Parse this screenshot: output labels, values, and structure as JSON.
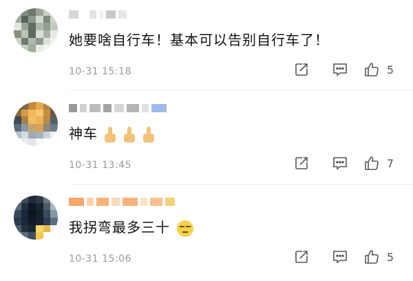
{
  "comments": [
    {
      "content": "她要啥自行车！基本可以告别自行车了！",
      "content_suffix": "",
      "emojis": [],
      "time": "10-31 15:18",
      "likes": "5",
      "avatar_colors": [
        "#b9c2b5",
        "#7f8c80",
        "#6d786a",
        "#9aa598",
        "#c6cdc2",
        "#eef0ed",
        "#a3ad9e",
        "#56655a",
        "#8d9a8b",
        "#d2d8cf",
        "#7b8a7a",
        "#cfd5cb",
        "#e3e7e0",
        "#99a696",
        "#616e62",
        "#adb8aa",
        "#90a08f",
        "#c1c9bd",
        "#84917f",
        "#bcc5b8",
        "#5e6b5c",
        "#d9dfd6",
        "#a9b3a5",
        "#e7eae4",
        "#cbd2c7",
        "#6f7d6c",
        "#b0b9ac",
        "#909b8d",
        "#dce1d8",
        "#f2f4f0",
        "#f0f2ee",
        "#c5ccc1",
        "#a1ab9e",
        "#e9ece6",
        "#f5f6f3",
        "#ffffff"
      ],
      "name_blocks": [
        "#d7d7d7",
        "#ffffff",
        "#e3e3e3",
        "#f0f0f0",
        "#c8c8c8",
        "#e6e6e6"
      ]
    },
    {
      "content": "神车",
      "content_suffix": "",
      "emojis": [
        "thumbs-up",
        "thumbs-up",
        "thumbs-up"
      ],
      "time": "10-31 13:45",
      "likes": "7",
      "avatar_colors": [
        "#4a5560",
        "#7a6a52",
        "#c48a3c",
        "#e3a94a",
        "#b3853f",
        "#5d4e3c",
        "#8c6b3c",
        "#d89b42",
        "#f0b85a",
        "#f6c874",
        "#c98f3f",
        "#6b5a44",
        "#3f4a55",
        "#a7824a",
        "#f2bf60",
        "#e9b256",
        "#b98a48",
        "#52606b",
        "#5a6d80",
        "#8b98a6",
        "#c9a36b",
        "#d6a35a",
        "#90867a",
        "#6a7b8c",
        "#b7c1cc",
        "#d5dbe1",
        "#9faab5",
        "#a7b1bb",
        "#cbd3da",
        "#eef1f4",
        "#ffffff",
        "#e9edf1",
        "#dfe5ea",
        "#f5f7f9",
        "#ffffff",
        "#ffffff"
      ],
      "name_blocks": [
        "#9a9a9a",
        "#cfcfcf",
        "#bdbdbd",
        "#a3a3a3",
        "#d6d6d6",
        "#b5b5b5",
        "#e0e0e0",
        "#9fb9e8"
      ]
    },
    {
      "content": "我拐弯最多三十",
      "content_suffix": "",
      "emojis": [
        "tired-face"
      ],
      "time": "10-31 15:06",
      "likes": "5",
      "avatar_colors": [
        "#8a9aa6",
        "#3e4c5c",
        "#1f2b38",
        "#2c3a48",
        "#6b7886",
        "#c9d0d6",
        "#58677a",
        "#203040",
        "#0f1824",
        "#1a2532",
        "#4c5a6a",
        "#a9b4bd",
        "#35465a",
        "#192736",
        "#0c141e",
        "#14202c",
        "#3b4a5c",
        "#8596a4",
        "#2a3a4c",
        "#1b2837",
        "#101b26",
        "#17222e",
        "#2e3d4f",
        "#5f6e7e",
        "#4a5a6c",
        "#24323f",
        "#1a2633",
        "#f7d46a",
        "#e8bb45",
        "#f2f2f2",
        "#8190a0",
        "#5c6b7b",
        "#404f60",
        "#f3c94d",
        "#ffffff",
        "#ffffff"
      ],
      "name_blocks": [
        "#f4a86a",
        "#ffd1b0",
        "#f7b37a",
        "#fbd9b8",
        "#f6b27d",
        "#ffe3c4",
        "#f8c08e",
        "#f5d27a"
      ]
    }
  ]
}
